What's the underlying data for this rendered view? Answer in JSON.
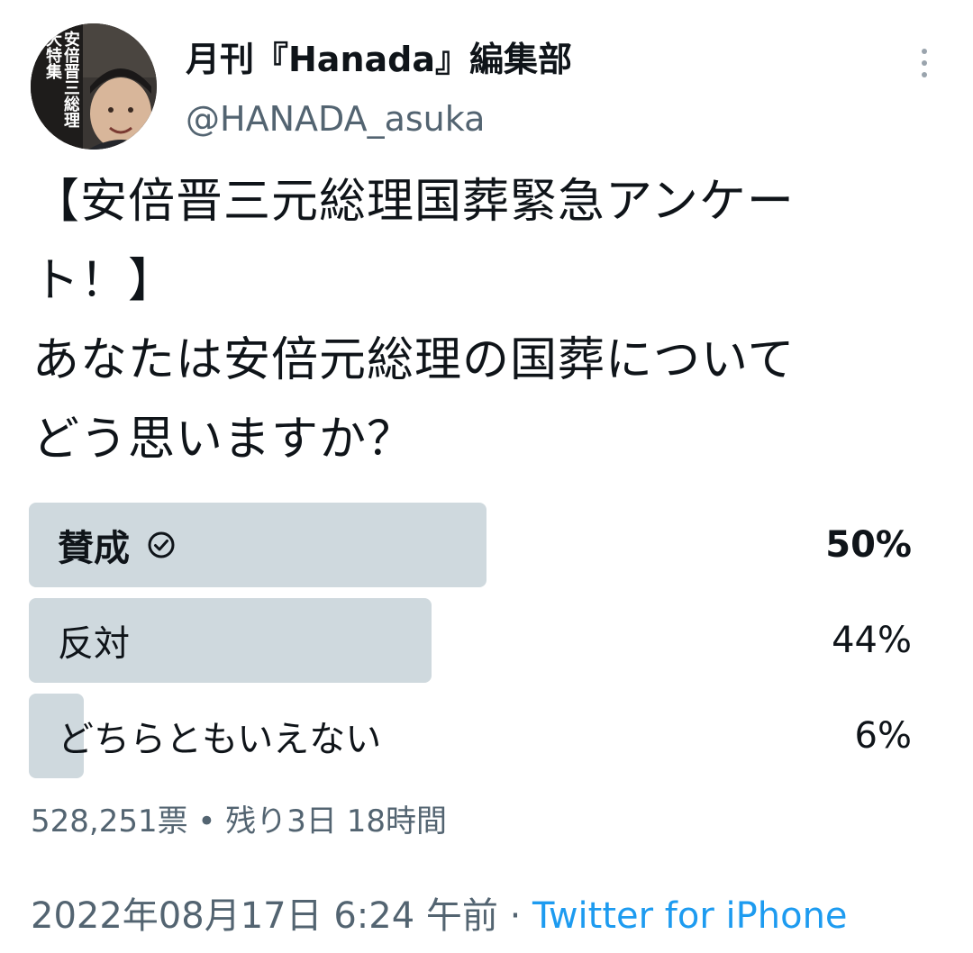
{
  "user": {
    "display_name": "月刊『Hanada』編集部",
    "handle": "@HANADA_asuka",
    "avatar_text": "安倍晋三総理 大特集"
  },
  "tweet": {
    "text_lines": [
      "【安倍晋三元総理国葬緊急アンケー",
      "ト！】",
      "あなたは安倍元総理の国葬について",
      "どう思いますか？"
    ]
  },
  "poll": {
    "options": [
      {
        "label": "賛成",
        "percent": "50%",
        "value": 50,
        "winner": true
      },
      {
        "label": "反対",
        "percent": "44%",
        "value": 44,
        "winner": false
      },
      {
        "label": "どちらともいえない",
        "percent": "6%",
        "value": 6,
        "winner": false
      }
    ],
    "votes": "528,251票",
    "separator": "•",
    "remaining": "残り3日 18時間",
    "bar_color": "#cfd9de"
  },
  "footer": {
    "date": "2022年08月17日",
    "time": "6:24 午前",
    "separator": "·",
    "source": "Twitter for iPhone",
    "source_color": "#1d9bf0"
  },
  "icons": {
    "more": "more-vertical-icon",
    "check": "check-circle-icon"
  }
}
